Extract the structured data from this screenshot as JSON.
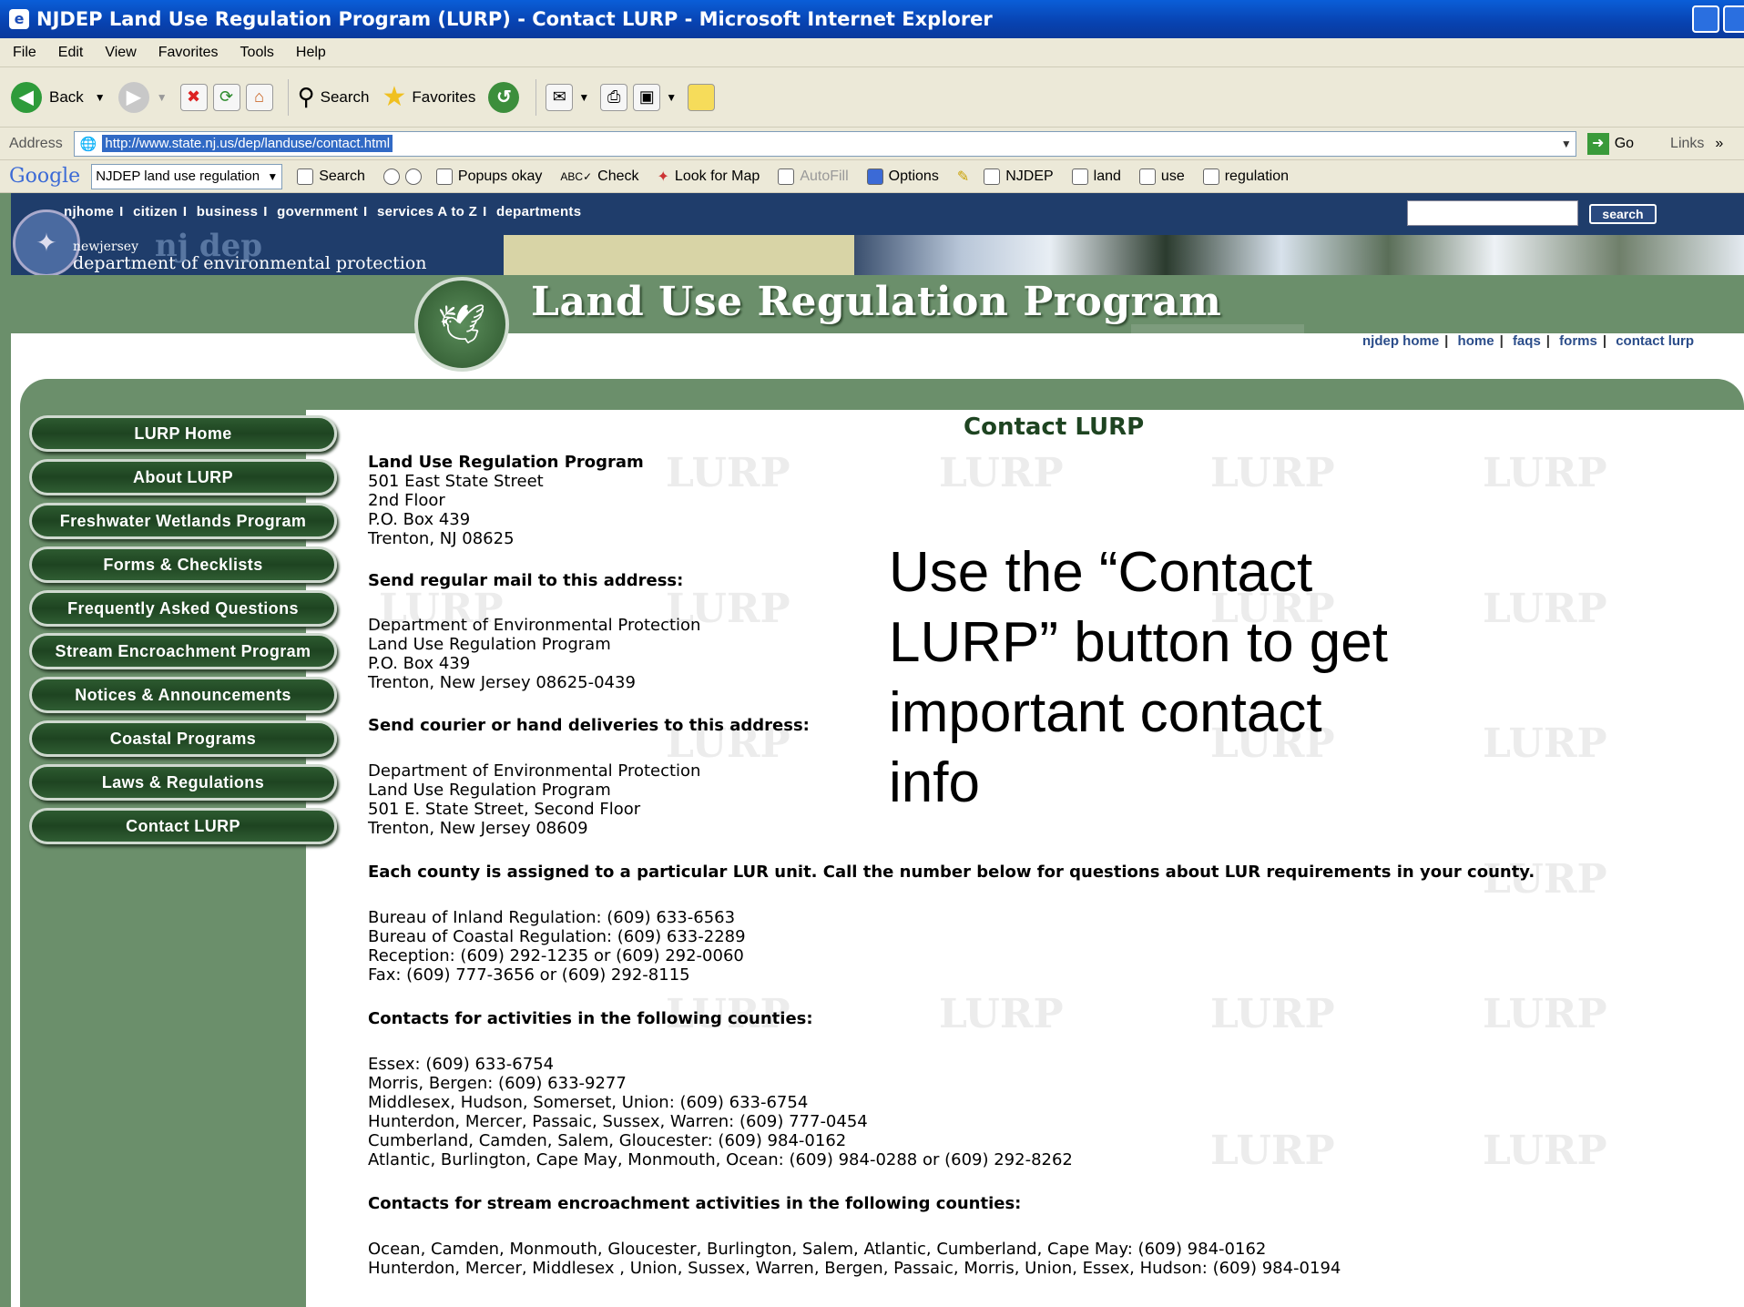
{
  "window": {
    "title": "NJDEP Land Use Regulation Program (LURP) - Contact LURP - Microsoft Internet Explorer"
  },
  "menu": [
    "File",
    "Edit",
    "View",
    "Favorites",
    "Tools",
    "Help"
  ],
  "toolbar": {
    "back": "Back",
    "search": "Search",
    "favorites": "Favorites"
  },
  "address": {
    "label": "Address",
    "url": "http://www.state.nj.us/dep/landuse/contact.html",
    "go": "Go",
    "links": "Links"
  },
  "googlebar": {
    "logo": "Google",
    "query": "NJDEP land use regulation",
    "search": "Search",
    "popups": "Popups okay",
    "check": "Check",
    "lookfor": "Look for Map",
    "autofill": "AutoFill",
    "options": "Options",
    "terms": [
      "NJDEP",
      "land",
      "use",
      "regulation"
    ]
  },
  "site": {
    "topnav": [
      "njhome",
      "citizen",
      "business",
      "government",
      "services A to Z",
      "departments"
    ],
    "search_button": "search",
    "dept_small": "newjersey",
    "dept_logo": "nj dep",
    "dept_name": "department of environmental protection",
    "program_title": "Land Use Regulation Program",
    "subnav": [
      "njdep home",
      "home",
      "faqs",
      "forms",
      "contact lurp"
    ]
  },
  "sidebar": [
    "LURP Home",
    "About LURP",
    "Freshwater Wetlands Program",
    "Forms & Checklists",
    "Frequently Asked Questions",
    "Stream Encroachment Program",
    "Notices & Announcements",
    "Coastal Programs",
    "Laws & Regulations",
    "Contact LURP"
  ],
  "watermark": "LURP",
  "content": {
    "title": "Contact LURP",
    "org_name": "Land Use Regulation Program",
    "org_address": [
      "501 East State Street",
      "2nd Floor",
      "P.O. Box 439",
      "Trenton, NJ 08625"
    ],
    "mail_heading": "Send regular mail to this address:",
    "mail_address": [
      "Department of Environmental Protection",
      "Land Use Regulation Program",
      "P.O. Box 439",
      "Trenton, New Jersey 08625-0439"
    ],
    "courier_heading": "Send courier or hand deliveries to this address:",
    "courier_address": [
      "Department of Environmental Protection",
      "Land Use Regulation Program",
      "501 E. State Street, Second Floor",
      "Trenton, New Jersey 08609"
    ],
    "county_note": "Each county is assigned to a particular LUR unit. Call the number below for questions about LUR requirements in your county.",
    "phones": [
      "Bureau of Inland Regulation: (609) 633-6563",
      "Bureau of Coastal Regulation: (609) 633-2289",
      "Reception: (609) 292-1235 or (609) 292-0060",
      "Fax: (609) 777-3656 or (609) 292-8115"
    ],
    "counties_heading": "Contacts for activities in the following counties:",
    "counties": [
      "Essex: (609) 633-6754",
      "Morris, Bergen: (609) 633-9277",
      "Middlesex, Hudson, Somerset, Union: (609) 633-6754",
      "Hunterdon, Mercer, Passaic, Sussex, Warren: (609) 777-0454",
      "Cumberland, Camden, Salem, Gloucester: (609) 984-0162",
      "Atlantic, Burlington, Cape May, Monmouth, Ocean: (609) 984-0288 or (609) 292-8262"
    ],
    "stream_heading": "Contacts for stream encroachment activities in the following counties:",
    "stream": [
      "Ocean, Camden, Monmouth, Gloucester, Burlington, Salem, Atlantic, Cumberland, Cape May: (609) 984-0162",
      "Hunterdon, Mercer, Middlesex , Union, Sussex, Warren, Bergen, Passaic, Morris, Union, Essex, Hudson: (609) 984-0194"
    ]
  },
  "callout": "Use the “Contact LURP” button to get important contact info"
}
